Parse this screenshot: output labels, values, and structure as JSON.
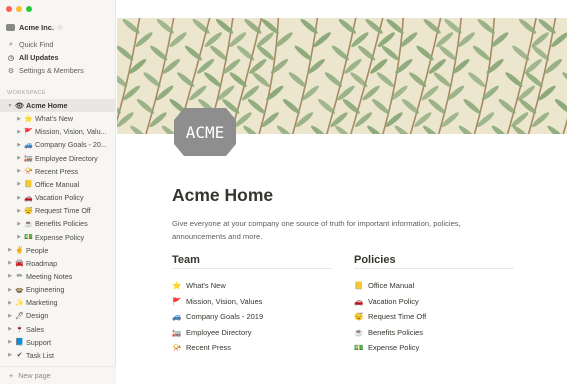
{
  "sidebar": {
    "workspace_name": "Acme Inc.",
    "workspace_caret": "◇",
    "nav": [
      {
        "label": "Quick Find",
        "icon": "search-icon",
        "glyph": "⌕"
      },
      {
        "label": "All Updates",
        "icon": "clock-icon",
        "glyph": "◷"
      },
      {
        "label": "Settings & Members",
        "icon": "gear-icon",
        "glyph": "⚙"
      }
    ],
    "section_label": "WORKSPACE",
    "tree": [
      {
        "label": "Acme Home",
        "emoji": "👁",
        "arrow": "▼",
        "depth": 0,
        "active": true
      },
      {
        "label": "What's New",
        "emoji": "⭐",
        "arrow": "▶",
        "depth": 1
      },
      {
        "label": "Mission, Vision, Valu...",
        "emoji": "🚩",
        "arrow": "▶",
        "depth": 1
      },
      {
        "label": "Company Goals - 20...",
        "emoji": "🚙",
        "arrow": "▶",
        "depth": 1
      },
      {
        "label": "Employee Directory",
        "emoji": "🏣",
        "arrow": "▶",
        "depth": 1
      },
      {
        "label": "Recent Press",
        "emoji": "📯",
        "arrow": "▶",
        "depth": 1
      },
      {
        "label": "Office Manual",
        "emoji": "📒",
        "arrow": "▶",
        "depth": 1
      },
      {
        "label": "Vacation Policy",
        "emoji": "🚗",
        "arrow": "▶",
        "depth": 1
      },
      {
        "label": "Request Time Off",
        "emoji": "😴",
        "arrow": "▶",
        "depth": 1
      },
      {
        "label": "Benefits Policies",
        "emoji": "☕",
        "arrow": "▶",
        "depth": 1
      },
      {
        "label": "Expense Policy",
        "emoji": "💵",
        "arrow": "▶",
        "depth": 1
      },
      {
        "label": "People",
        "emoji": "✌",
        "arrow": "▶",
        "depth": 0
      },
      {
        "label": "Roadmap",
        "emoji": "🚘",
        "arrow": "▶",
        "depth": 0
      },
      {
        "label": "Meeting Notes",
        "emoji": "✏",
        "arrow": "▶",
        "depth": 0
      },
      {
        "label": "Engineering",
        "emoji": "🍲",
        "arrow": "▶",
        "depth": 0
      },
      {
        "label": "Marketing",
        "emoji": "✨",
        "arrow": "▶",
        "depth": 0
      },
      {
        "label": "Design",
        "emoji": "🖊",
        "arrow": "▶",
        "depth": 0
      },
      {
        "label": "Sales",
        "emoji": "🍷",
        "arrow": "▶",
        "depth": 0
      },
      {
        "label": "Support",
        "emoji": "📘",
        "arrow": "▶",
        "depth": 0
      },
      {
        "label": "Task List",
        "emoji": "✔",
        "arrow": "▶",
        "depth": 0
      }
    ],
    "new_page_label": "New page",
    "new_page_glyph": "+"
  },
  "page": {
    "icon_text": "ACME",
    "title": "Acme Home",
    "description": "Give everyone at your company one source of truth for important information, policies, announcements and more.",
    "team": {
      "heading": "Team",
      "items": [
        {
          "label": "What's New",
          "emoji": "⭐"
        },
        {
          "label": "Mission, Vision, Values",
          "emoji": "🚩"
        },
        {
          "label": "Company Goals - 2019",
          "emoji": "🚙"
        },
        {
          "label": "Employee Directory",
          "emoji": "🏣"
        },
        {
          "label": "Recent Press",
          "emoji": "📯"
        }
      ]
    },
    "policies": {
      "heading": "Policies",
      "items": [
        {
          "label": "Office Manual",
          "emoji": "📒"
        },
        {
          "label": "Vacation Policy",
          "emoji": "🚗"
        },
        {
          "label": "Request Time Off",
          "emoji": "😴"
        },
        {
          "label": "Benefits Policies",
          "emoji": "☕"
        },
        {
          "label": "Expense Policy",
          "emoji": "💵"
        }
      ]
    }
  },
  "colors": {
    "window_close": "#fe5f57",
    "window_minimize": "#febc2e",
    "window_maximize": "#28c840",
    "sidebar_bg": "#f7f6f3",
    "cover_bg": "#ece6cf",
    "leaf_green": "#8aa878",
    "stem_brown": "#a58b63",
    "icon_gray": "#8e8e8e"
  }
}
